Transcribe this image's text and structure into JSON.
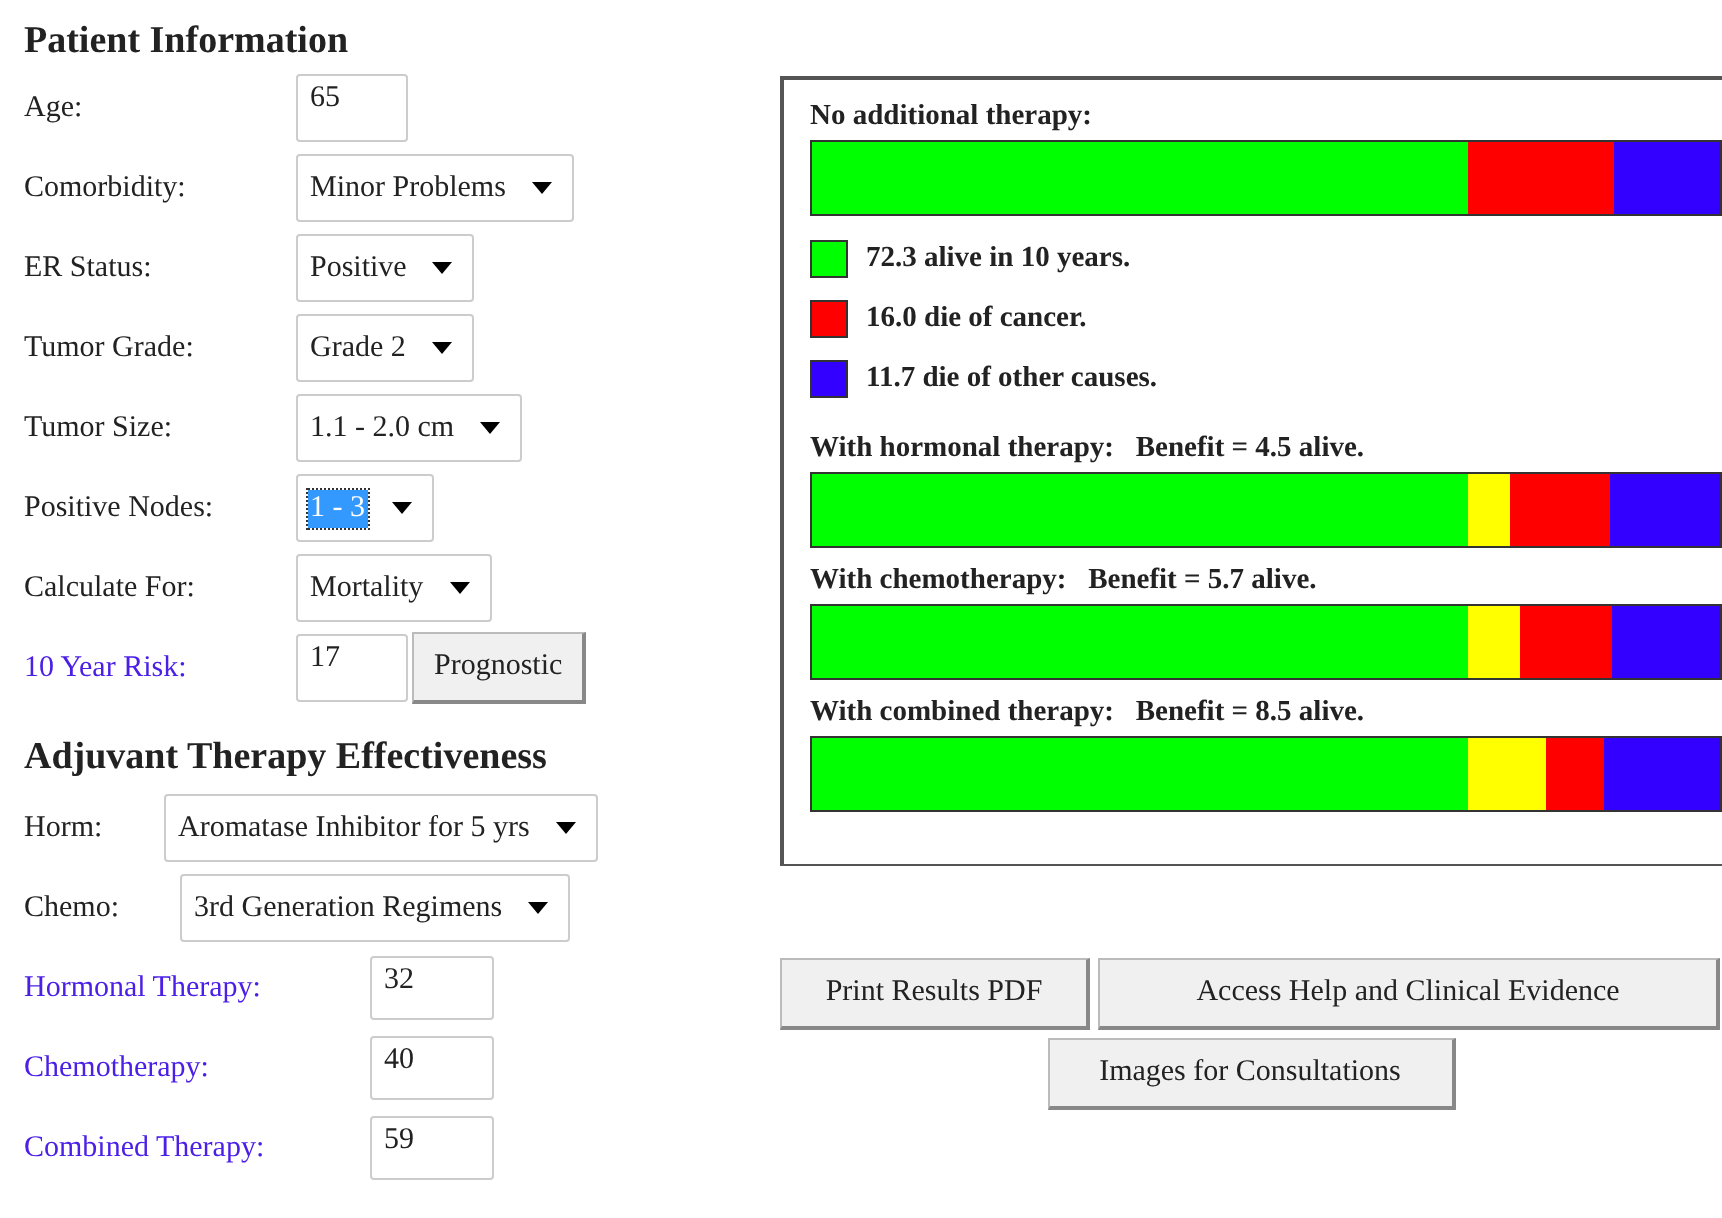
{
  "patient_information": {
    "heading": "Patient Information",
    "fields": [
      {
        "label": "Age:",
        "kind": "input",
        "value": "65"
      },
      {
        "label": "Comorbidity:",
        "kind": "select",
        "value": "Minor Problems"
      },
      {
        "label": "ER Status:",
        "kind": "select",
        "value": "Positive"
      },
      {
        "label": "Tumor Grade:",
        "kind": "select",
        "value": "Grade 2"
      },
      {
        "label": "Tumor Size:",
        "kind": "select",
        "value": "1.1 - 2.0 cm"
      },
      {
        "label": "Positive Nodes:",
        "kind": "select",
        "value": "1 - 3",
        "highlighted": true
      },
      {
        "label": "Calculate For:",
        "kind": "select",
        "value": "Mortality"
      },
      {
        "label": "10 Year Risk:",
        "kind": "output",
        "value": "17",
        "button": "Prognostic"
      }
    ]
  },
  "adjuvant_therapy": {
    "heading": "Adjuvant Therapy Effectiveness",
    "selects": [
      {
        "label": "Horm:",
        "value": "Aromatase Inhibitor for 5 yrs"
      },
      {
        "label": "Chemo:",
        "value": "3rd Generation Regimens"
      }
    ],
    "outputs": [
      {
        "label": "Hormonal Therapy:",
        "value": "32"
      },
      {
        "label": "Chemotherapy:",
        "value": "40"
      },
      {
        "label": "Combined Therapy:",
        "value": "59"
      }
    ]
  },
  "results": {
    "sections": [
      {
        "title": "No additional therapy:",
        "segments": [
          {
            "color": "#00ff00"
          },
          {
            "color": "#ff0000"
          },
          {
            "color": "#3300ff"
          }
        ],
        "legend": [
          {
            "color": "#00ff00",
            "text": "72.3 alive in 10 years."
          },
          {
            "color": "#ff0000",
            "text": "16.0 die of cancer."
          },
          {
            "color": "#3300ff",
            "text": "11.7 die of other causes."
          }
        ]
      },
      {
        "title": "With hormonal therapy:   Benefit = 4.5 alive.",
        "segments": [
          {
            "color": "#00ff00"
          },
          {
            "color": "#ffff00"
          },
          {
            "color": "#ff0000"
          },
          {
            "color": "#3300ff"
          }
        ]
      },
      {
        "title": "With chemotherapy:   Benefit = 5.7 alive.",
        "segments": [
          {
            "color": "#00ff00"
          },
          {
            "color": "#ffff00"
          },
          {
            "color": "#ff0000"
          },
          {
            "color": "#3300ff"
          }
        ]
      },
      {
        "title": "With combined therapy:   Benefit = 8.5 alive.",
        "segments": [
          {
            "color": "#00ff00"
          },
          {
            "color": "#ffff00"
          },
          {
            "color": "#ff0000"
          },
          {
            "color": "#3300ff"
          }
        ]
      }
    ]
  },
  "buttons": [
    "Print Results PDF",
    "Access Help and Clinical Evidence",
    "Images for Consultations"
  ]
}
